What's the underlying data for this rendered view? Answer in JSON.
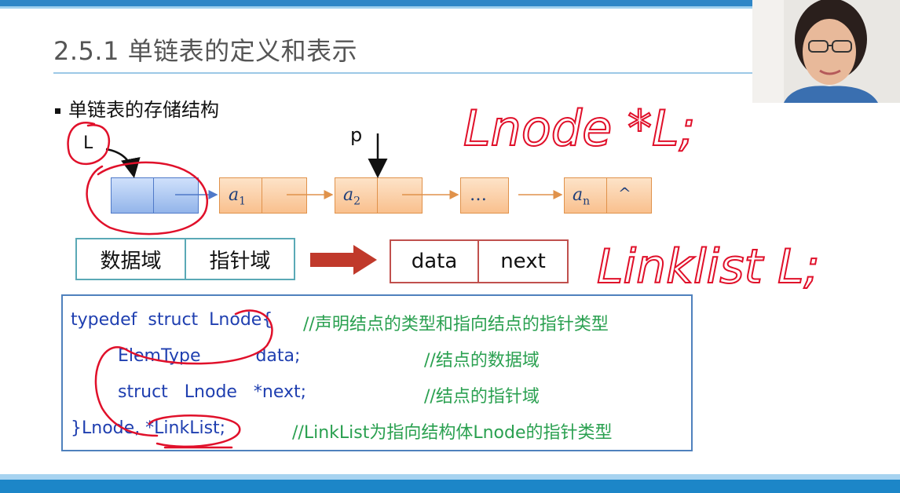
{
  "slide": {
    "title": "2.5.1 单链表的定义和表示",
    "bullet": "单链表的存储结构"
  },
  "diagram": {
    "head_label": "L",
    "pointer_label": "p",
    "nodes": [
      {
        "data": "a",
        "sub": "1"
      },
      {
        "data": "a",
        "sub": "2"
      },
      {
        "data": "…",
        "sub": ""
      },
      {
        "data": "a",
        "sub": "n",
        "next": "^"
      }
    ],
    "domain_box": [
      "数据域",
      "指针域"
    ],
    "field_box": [
      "data",
      "next"
    ]
  },
  "code": {
    "lines": [
      {
        "code": "typedef  struct  Lnode{",
        "comment": "//声明结点的类型和指向结点的指针类型"
      },
      {
        "code": "ElemType          data;",
        "comment": "//结点的数据域"
      },
      {
        "code": "struct   Lnode   *next;",
        "comment": "//结点的指针域"
      },
      {
        "code": "}Lnode, *LinkList;",
        "comment": "//LinkList为指向结构体Lnode的指针类型"
      }
    ]
  },
  "handwriting": {
    "text1": "Lnode *L;",
    "text2": "Linklist L;"
  },
  "colors": {
    "accent": "#2e86c7",
    "node_orange": "#f9c08e",
    "node_blue": "#93b5ea",
    "ink_red": "#e0102a",
    "code_blue": "#1f3fb0",
    "comment_green": "#2aa050"
  }
}
